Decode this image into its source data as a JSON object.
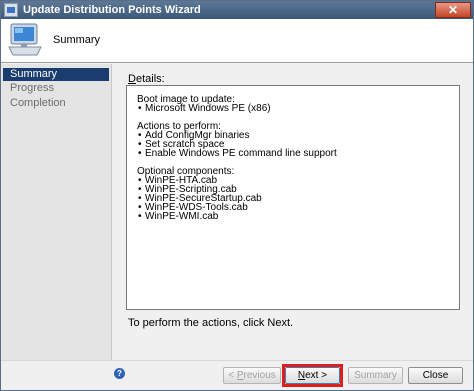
{
  "window": {
    "title": "Update Distribution Points Wizard",
    "close_glyph": "✕"
  },
  "header": {
    "page_title": "Summary",
    "icon": "computer-monitor-icon"
  },
  "sidebar": {
    "items": [
      {
        "label": "Summary",
        "active": true
      },
      {
        "label": "Progress",
        "active": false
      },
      {
        "label": "Completion",
        "active": false
      }
    ]
  },
  "content": {
    "details_label_first": "D",
    "details_label_rest": "etails:",
    "sections": [
      {
        "heading": "Boot image to update:",
        "items": [
          "Microsoft Windows PE (x86)"
        ]
      },
      {
        "heading": "Actions to perform:",
        "items": [
          "Add ConfigMgr binaries",
          "Set scratch space",
          "Enable Windows PE command line support"
        ]
      },
      {
        "heading": "Optional components:",
        "items": [
          "WinPE-HTA.cab",
          "WinPE-Scripting.cab",
          "WinPE-SecureStartup.cab",
          "WinPE-WDS-Tools.cab",
          "WinPE-WMI.cab"
        ]
      }
    ],
    "footer_note": "To perform the actions, click Next."
  },
  "buttons": {
    "previous": {
      "pre": "< ",
      "u": "P",
      "post": "revious"
    },
    "next": {
      "u": "N",
      "post": "ext >"
    },
    "summary": "Summary",
    "close": "Close"
  },
  "help_icon": "?",
  "colors": {
    "highlight": "#e01c1c",
    "sidebar_active": "#1b3c6e",
    "titlebar": "#3b587a"
  }
}
